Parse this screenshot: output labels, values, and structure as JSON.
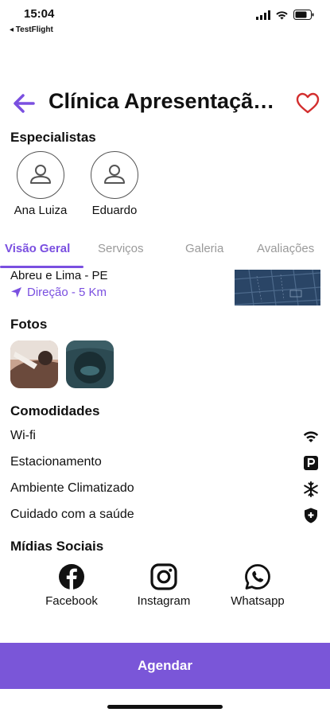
{
  "status_bar": {
    "time": "15:04",
    "back_app": "◂ TestFlight",
    "icons": [
      "signal-icon",
      "wifi-icon",
      "battery-icon"
    ]
  },
  "header": {
    "title": "Clínica Apresentação Teste",
    "back_icon": "arrow-left-icon",
    "favorite_icon": "heart-icon",
    "accent_color": "#7a4fe0",
    "favorite_color": "#d32f2f"
  },
  "specialists": {
    "title": "Especialistas",
    "items": [
      {
        "name": "Ana Luiza",
        "icon": "user-icon"
      },
      {
        "name": "Eduardo",
        "icon": "user-icon"
      }
    ]
  },
  "tabs": {
    "items": [
      {
        "label": "Visão Geral",
        "active": true
      },
      {
        "label": "Serviços",
        "active": false
      },
      {
        "label": "Galeria",
        "active": false
      },
      {
        "label": "Avaliações",
        "active": false
      }
    ]
  },
  "location": {
    "address": "Abreu e Lima - PE",
    "direction": "Direção - 5 Km",
    "direction_icon": "navigation-arrow-icon",
    "map_thumbnail": "map-thumbnail"
  },
  "photos": {
    "title": "Fotos",
    "items": [
      "photo-1",
      "photo-2"
    ]
  },
  "amenities": {
    "title": "Comodidades",
    "items": [
      {
        "label": "Wi-fi",
        "icon": "wifi-icon"
      },
      {
        "label": "Estacionamento",
        "icon": "parking-icon"
      },
      {
        "label": "Ambiente Climatizado",
        "icon": "snowflake-icon"
      },
      {
        "label": "Cuidado com a saúde",
        "icon": "shield-plus-icon"
      }
    ]
  },
  "social": {
    "title": "Mídias Sociais",
    "items": [
      {
        "label": "Facebook",
        "icon": "facebook-icon"
      },
      {
        "label": "Instagram",
        "icon": "instagram-icon"
      },
      {
        "label": "Whatsapp",
        "icon": "whatsapp-icon"
      }
    ]
  },
  "cta": {
    "label": "Agendar",
    "color": "#7a56d8"
  }
}
